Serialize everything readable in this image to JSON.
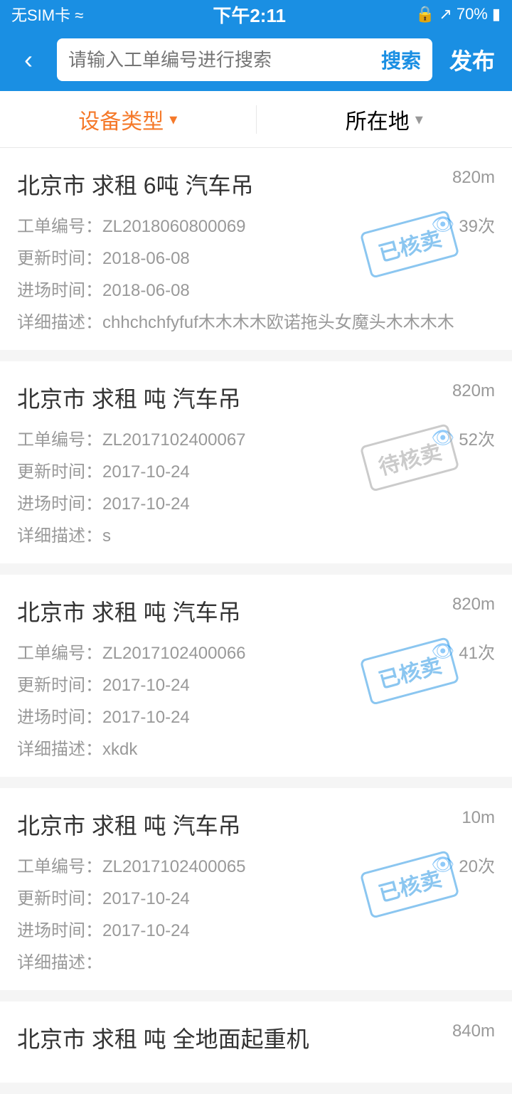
{
  "statusBar": {
    "left": "无SIM卡 ≈",
    "center": "下午2:11",
    "lock": "🔒",
    "signal": "↗",
    "battery": "70%"
  },
  "navBar": {
    "backIcon": "‹",
    "searchPlaceholder": "请输入工单编号进行搜索",
    "searchBtn": "搜索",
    "publishBtn": "发布"
  },
  "filterBar": {
    "deviceType": "设备类型",
    "location": "所在地"
  },
  "items": [
    {
      "id": 1,
      "title": "北京市 求租 6吨 汽车吊",
      "distance": "820m",
      "orderNo": "工单编号：ZL2018060800069",
      "views": "39次",
      "updateDate": "更新时间：2018-06-08",
      "entryDate": "进场时间：2018-06-08",
      "desc": "详细描述：chhchchfyfuf木木木木欧诺拖头女魔头木木木木",
      "stamp": "已核卖",
      "stampType": "sold"
    },
    {
      "id": 2,
      "title": "北京市 求租 吨 汽车吊",
      "distance": "820m",
      "orderNo": "工单编号：ZL2017102400067",
      "views": "52次",
      "updateDate": "更新时间：2017-10-24",
      "entryDate": "进场时间：2017-10-24",
      "desc": "详细描述：s",
      "stamp": "待核卖",
      "stampType": "pending"
    },
    {
      "id": 3,
      "title": "北京市 求租 吨 汽车吊",
      "distance": "820m",
      "orderNo": "工单编号：ZL2017102400066",
      "views": "41次",
      "updateDate": "更新时间：2017-10-24",
      "entryDate": "进场时间：2017-10-24",
      "desc": "详细描述：xkdk",
      "stamp": "已核卖",
      "stampType": "sold"
    },
    {
      "id": 4,
      "title": "北京市 求租 吨 汽车吊",
      "distance": "10m",
      "orderNo": "工单编号：ZL2017102400065",
      "views": "20次",
      "updateDate": "更新时间：2017-10-24",
      "entryDate": "进场时间：2017-10-24",
      "desc": "详细描述：",
      "stamp": "已核卖",
      "stampType": "sold"
    },
    {
      "id": 5,
      "title": "北京市 求租 吨 全地面起重机",
      "distance": "840m",
      "orderNo": "",
      "views": "",
      "updateDate": "",
      "entryDate": "",
      "desc": "",
      "stamp": "",
      "stampType": ""
    }
  ]
}
